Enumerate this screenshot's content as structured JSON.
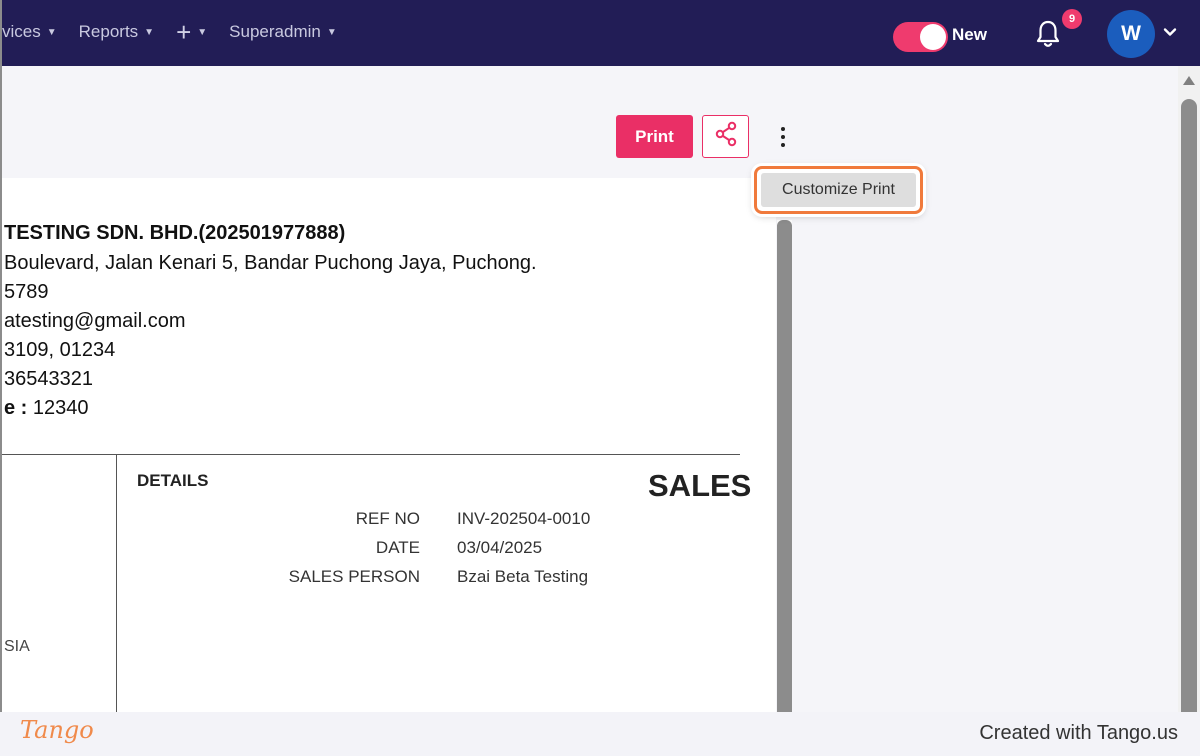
{
  "nav": {
    "items": [
      {
        "label": "vices"
      },
      {
        "label": "Reports"
      },
      {
        "label": "+"
      },
      {
        "label": "Superadmin"
      }
    ],
    "toggle_label": "New",
    "toggle_on": true,
    "notification_count": "9",
    "avatar_initial": "W"
  },
  "toolbar": {
    "print_label": "Print",
    "share_icon": "share-icon",
    "more_icon": "kebab-icon"
  },
  "menu": {
    "customize_print_label": "Customize Print"
  },
  "document": {
    "company_lines": [
      "TESTING SDN. BHD.(202501977888)",
      "Boulevard, Jalan Kenari 5, Bandar Puchong Jaya, Puchong.",
      "5789",
      "atesting@gmail.com",
      "3109, 01234",
      "36543321"
    ],
    "code_label": "e :",
    "code_value": "12340",
    "details_title": "DETAILS",
    "sales_title": "SALES",
    "details": [
      {
        "label": "REF NO",
        "value": "INV-202504-0010"
      },
      {
        "label": "DATE",
        "value": "03/04/2025"
      },
      {
        "label": "SALES PERSON",
        "value": "Bzai Beta Testing"
      }
    ],
    "country_fragment": "SIA"
  },
  "footer": {
    "logo": "Tango",
    "credit": "Created with Tango.us"
  },
  "colors": {
    "nav_bg": "#221d56",
    "accent": "#ea2f66",
    "highlight": "#f07a3c",
    "avatar": "#1b5dbd"
  }
}
